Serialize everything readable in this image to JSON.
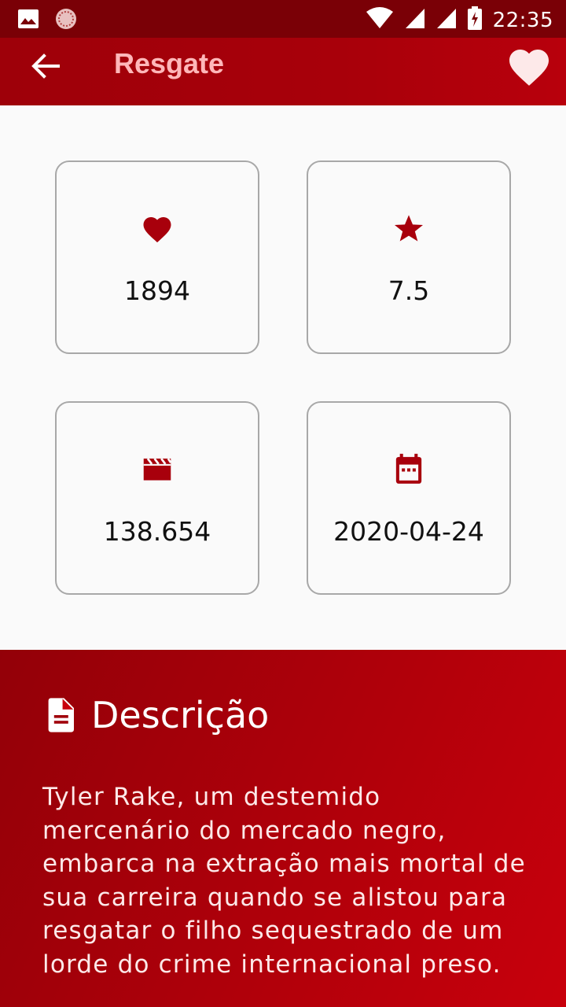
{
  "status_bar": {
    "time": "22:35",
    "left_icons": [
      "image-icon",
      "app-notification-icon"
    ],
    "right_icons": [
      "wifi-icon",
      "signal-icon",
      "signal-icon-2",
      "battery-charging-icon"
    ]
  },
  "app_bar": {
    "title": "Resgate",
    "back_icon": "arrow-back-icon",
    "favorite_icon": "heart-icon"
  },
  "stats": [
    {
      "icon": "heart-icon",
      "value": "1894"
    },
    {
      "icon": "star-icon",
      "value": "7.5"
    },
    {
      "icon": "movie-clapper-icon",
      "value": "138.654"
    },
    {
      "icon": "calendar-icon",
      "value": "2020-04-24"
    }
  ],
  "description": {
    "title": "Descrição",
    "icon": "document-icon",
    "text": "Tyler Rake, um destemido mercenário do mercado negro, embarca na extração mais mortal de sua carreira quando se alistou para resgatar o filho sequestrado de um lorde do crime internacional preso."
  },
  "colors": {
    "primary": "#a0000a",
    "status_bar": "#7a0006",
    "title_text": "#ffb7b9",
    "icon_accent": "#a8000c"
  }
}
